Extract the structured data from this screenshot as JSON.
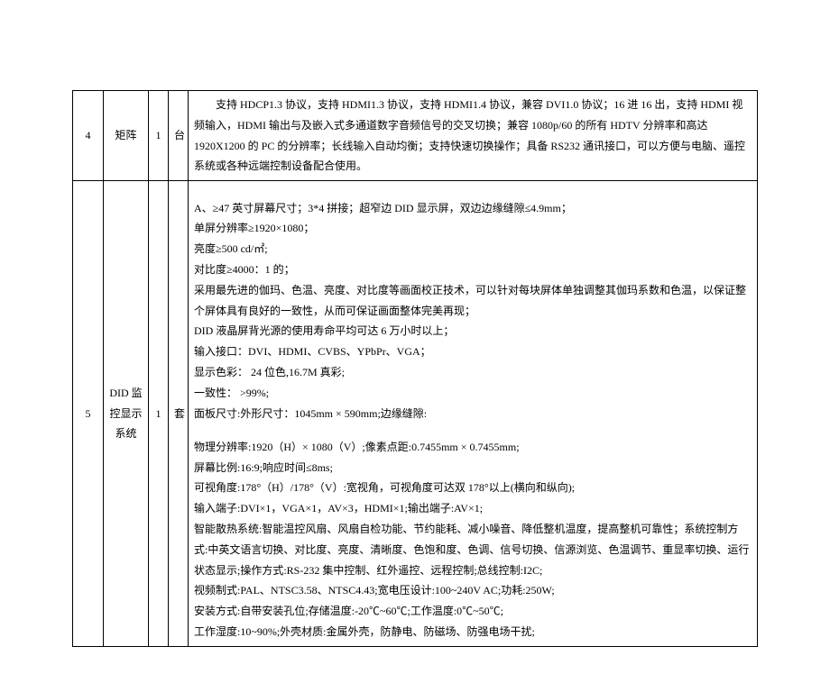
{
  "rows": [
    {
      "num": "4",
      "name": "矩阵",
      "qty": "1",
      "unit": "台",
      "desc_lines": [
        "支持 HDCP1.3 协议，支持 HDMI1.3 协议，支持 HDMI1.4 协议，兼容 DVI1.0 协议；16 进 16 出，支持 HDMI 视频输入，HDMI 输出与及嵌入式多通道数字音频信号的交叉切换；兼容 1080p/60 的所有 HDTV 分辨率和高达 1920X1200 的 PC 的分辨率；长线输入自动均衡；支持快速切换操作；具备 RS232 通讯接口，可以方便与电脑、遥控系统或各种远端控制设备配合使用。"
      ]
    },
    {
      "num": "5",
      "name": "DID 监控显示系统",
      "qty": "1",
      "unit": "套",
      "desc_lines": [
        "",
        "A、≥47 英寸屏幕尺寸；3*4 拼接；超窄边 DID 显示屏，双边边缘缝隙≤4.9mm；",
        "单屏分辨率≥1920×1080；",
        "亮度≥500 cd/㎡;",
        "对比度≥4000：1 的；",
        "采用最先进的伽玛、色温、亮度、对比度等画面校正技术，可以针对每块屏体单独调整其伽玛系数和色温，以保证整个屏体具有良好的一致性，从而可保证画面整体完美再现；",
        " DID 液晶屏背光源的使用寿命平均可达 6 万小时以上；",
        "输入接口：DVI、HDMI、CVBS、YPbPr、VGA；",
        "显示色彩：  24 位色,16.7M 真彩;",
        "  一致性：  >99%;",
        "面板尺寸:外形尺寸：1045mm × 590mm;边缘缝隙:",
        "",
        "物理分辨率:1920（H）× 1080（V）;像素点距:0.7455mm × 0.7455mm;",
        "屏幕比例:16:9;响应时间≤8ms;",
        "可视角度:178°（H）/178°（V）:宽视角，可视角度可达双 178°以上(横向和纵向);",
        "输入端子:DVI×1，VGA×1，AV×3，HDMI×1;输出端子:AV×1;",
        "智能散热系统:智能温控风扇、风扇自检功能、节约能耗、减小噪音、降低整机温度，提高整机可靠性；系统控制方式:中英文语言切换、对比度、亮度、清晰度、色饱和度、色调、信号切换、信源浏览、色温调节、重显率切换、运行状态显示;操作方式:RS-232 集中控制、红外遥控、远程控制;总线控制:I2C;",
        "视频制式:PAL、NTSC3.58、NTSC4.43;宽电压设计:100~240V AC;功耗:250W;",
        "安装方式:自带安装孔位;存储温度:-20℃~60℃;工作温度:0℃~50℃;",
        "工作湿度:10~90%;外壳材质:金属外壳，防静电、防磁场、防强电场干扰;"
      ]
    }
  ]
}
